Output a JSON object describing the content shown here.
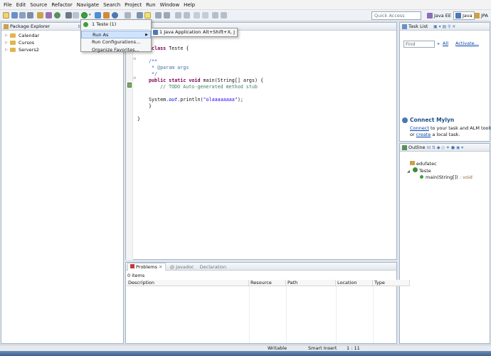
{
  "menubar": [
    "File",
    "Edit",
    "Source",
    "Refactor",
    "Navigate",
    "Search",
    "Project",
    "Run",
    "Window",
    "Help"
  ],
  "toolbar": {
    "quick_access_placeholder": "Quick Access"
  },
  "perspectives": [
    "Java EE",
    "Java",
    "JPA"
  ],
  "package_explorer": {
    "title": "Package Explorer",
    "items": [
      "Calendar",
      "Cursos",
      "Servers2"
    ]
  },
  "run_dropdown": {
    "recent": "1 Teste (1)",
    "items": [
      "Run As",
      "Run Configurations...",
      "Organize Favorites..."
    ]
  },
  "run_as_submenu": {
    "label": "1 Java Application",
    "shortcut": "Alt+Shift+X, J"
  },
  "editor": {
    "lines": {
      "class_decl_kw": "c class",
      "class_decl_rest": " Teste {",
      "doc_open": "/**",
      "doc_param_star": " * ",
      "doc_param": "@param args",
      "doc_close": " */",
      "main_kw": "public static void",
      "main_rest": " main(String[] args) {",
      "todo": "// TODO Auto-generated method stub",
      "sys_pre": "System.",
      "sys_out": "out",
      "sys_post": ".println(",
      "sys_str": "\"olaaaaaaaa\"",
      "sys_end": ");",
      "close1": "}",
      "close2": "}"
    }
  },
  "task_list": {
    "title": "Task List",
    "find_placeholder": "Find",
    "all_label": "All",
    "activate_label": "Activate...",
    "mylyn_title": "Connect Mylyn",
    "mylyn_connect": "Connect",
    "mylyn_text1": " to your task and ALM tools",
    "mylyn_text2_pre": "or ",
    "mylyn_create": "create",
    "mylyn_text2_post": " a local task."
  },
  "outline": {
    "title": "Outline",
    "package": "edufatec",
    "class": "Teste",
    "method": "main(String[])",
    "method_type": " : void"
  },
  "problems": {
    "tabs": [
      "Problems",
      "Javadoc",
      "Declaration"
    ],
    "count": "0 items",
    "columns": [
      "Description",
      "Resource",
      "Path",
      "Location",
      "Type"
    ]
  },
  "status": {
    "writable": "Writable",
    "insert": "Smart Insert",
    "position": "1 : 11"
  }
}
